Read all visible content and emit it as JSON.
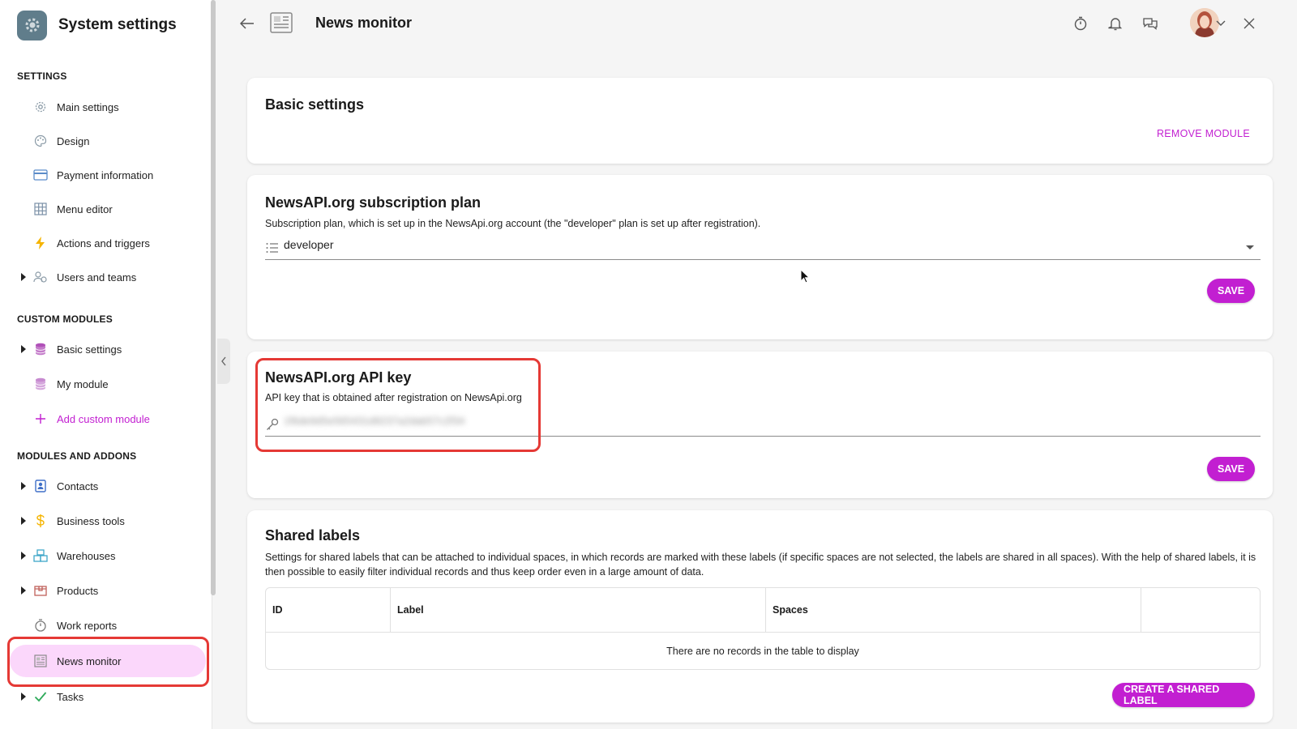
{
  "app": {
    "title": "System settings"
  },
  "sidebar": {
    "sections": [
      {
        "title": "SETTINGS"
      },
      {
        "title": "CUSTOM MODULES"
      },
      {
        "title": "MODULES AND ADDONS"
      }
    ],
    "settings_items": [
      {
        "label": "Main settings",
        "icon": "gear-icon"
      },
      {
        "label": "Design",
        "icon": "palette-icon"
      },
      {
        "label": "Payment information",
        "icon": "credit-card-icon"
      },
      {
        "label": "Menu editor",
        "icon": "grid-icon"
      },
      {
        "label": "Actions and triggers",
        "icon": "lightning-icon"
      },
      {
        "label": "Users and teams",
        "icon": "users-icon"
      }
    ],
    "custom_items": [
      {
        "label": "Basic settings",
        "icon": "database-icon"
      },
      {
        "label": "My module",
        "icon": "database-icon"
      },
      {
        "label": "Add custom module",
        "icon": "plus-icon"
      }
    ],
    "module_items": [
      {
        "label": "Contacts",
        "icon": "contacts-icon"
      },
      {
        "label": "Business tools",
        "icon": "dollar-icon"
      },
      {
        "label": "Warehouses",
        "icon": "warehouse-icon"
      },
      {
        "label": "Products",
        "icon": "box-icon"
      },
      {
        "label": "Work reports",
        "icon": "stopwatch-icon"
      },
      {
        "label": "News monitor",
        "icon": "newspaper-icon",
        "active": true
      },
      {
        "label": "Tasks",
        "icon": "check-icon"
      }
    ]
  },
  "header": {
    "title": "News monitor"
  },
  "basic_settings": {
    "title": "Basic settings",
    "remove_label": "REMOVE MODULE"
  },
  "subscription": {
    "title": "NewsAPI.org subscription plan",
    "description": "Subscription plan, which is set up in the NewsApi.org account (the \"developer\" plan is set up after registration).",
    "value": "developer",
    "save_label": "SAVE"
  },
  "api_key": {
    "title": "NewsAPI.org API key",
    "description": "API key that is obtained after registration on NewsApi.org",
    "value": "1f6de9d5e565431d9237a2dab57c2f34",
    "save_label": "SAVE"
  },
  "shared_labels": {
    "title": "Shared labels",
    "description": "Settings for shared labels that can be attached to individual spaces, in which records are marked with these labels (if specific spaces are not selected, the labels are shared in all spaces). With the help of shared labels, it is then possible to easily filter individual records and thus keep order even in a large amount of data.",
    "columns": [
      "ID",
      "Label",
      "Spaces",
      ""
    ],
    "empty_message": "There are no records in the table to display",
    "create_label": "CREATE A SHARED LABEL"
  },
  "colors": {
    "accent": "#c21fd1",
    "active_bg": "#fbd7fb",
    "highlight": "#e53935"
  }
}
